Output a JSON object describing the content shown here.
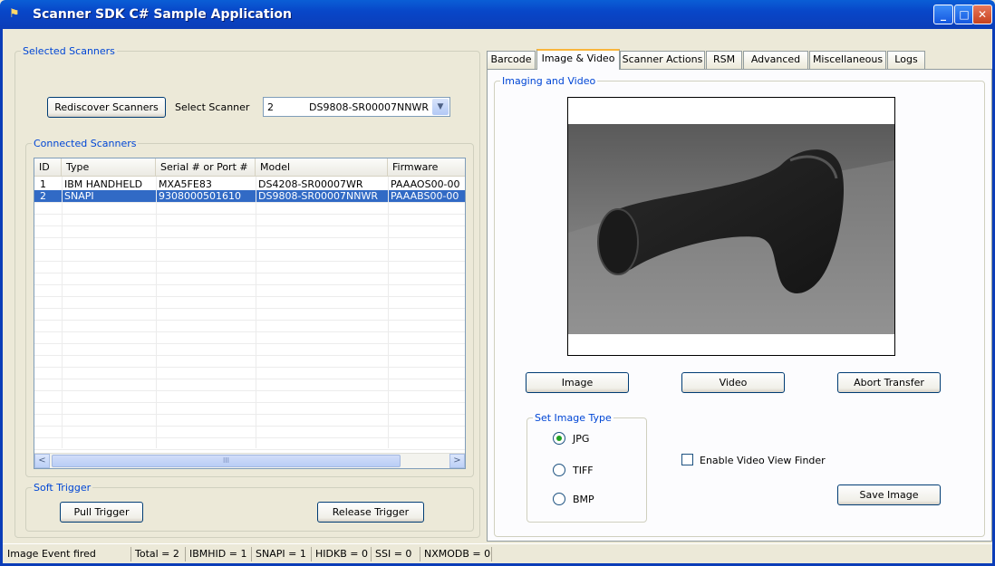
{
  "window": {
    "title": "Scanner SDK C# Sample Application",
    "buttons": {
      "minimize": "_",
      "maximize": "□",
      "close": "✕"
    }
  },
  "selected_scanners": {
    "legend": "Selected Scanners",
    "rediscover_label": "Rediscover Scanners",
    "select_scanner_label": "Select Scanner",
    "selected_id": "2",
    "selected_model": "DS9808-SR00007NNWR"
  },
  "connected_scanners": {
    "legend": "Connected Scanners",
    "columns": [
      "ID",
      "Type",
      "Serial # or Port #",
      "Model",
      "Firmware"
    ],
    "rows": [
      {
        "id": "1",
        "type": "IBM HANDHELD",
        "serial": "MXA5FE83",
        "model": "DS4208-SR00007WR",
        "firmware": "PAAAOS00-00"
      },
      {
        "id": "2",
        "type": "SNAPI",
        "serial": "9308000501610",
        "model": "DS9808-SR00007NNWR",
        "firmware": "PAAABS00-00"
      }
    ],
    "selected_row": 1,
    "scroll_left": "<",
    "scroll_right": ">",
    "scroll_grip": "III"
  },
  "soft_trigger": {
    "legend": "Soft Trigger",
    "pull_label": "Pull Trigger",
    "release_label": "Release Trigger"
  },
  "tabs": [
    "Barcode",
    "Image & Video",
    "Scanner Actions",
    "RSM",
    "Advanced",
    "Miscellaneous",
    "Logs"
  ],
  "active_tab": "Image & Video",
  "imaging": {
    "legend": "Imaging and Video",
    "image_button": "Image",
    "video_button": "Video",
    "abort_button": "Abort Transfer",
    "image_type_legend": "Set Image Type",
    "image_types": [
      "JPG",
      "TIFF",
      "BMP"
    ],
    "selected_image_type": "JPG",
    "video_view_finder_label": "Enable Video View Finder",
    "video_view_finder_checked": false,
    "save_button": "Save Image"
  },
  "status_bar": {
    "message": "Image Event fired",
    "total": "Total = 2",
    "ibmhid": "IBMHID = 1",
    "snapi": "SNAPI = 1",
    "hidkb": "HIDKB = 0",
    "ssi": "SSI = 0",
    "nxmodb": "NXMODB = 0"
  },
  "colors": {
    "titlebar": "#0846c8",
    "selection": "#316ac5",
    "group_legend": "#0046d5",
    "active_tab_accent": "#f9b53c"
  }
}
